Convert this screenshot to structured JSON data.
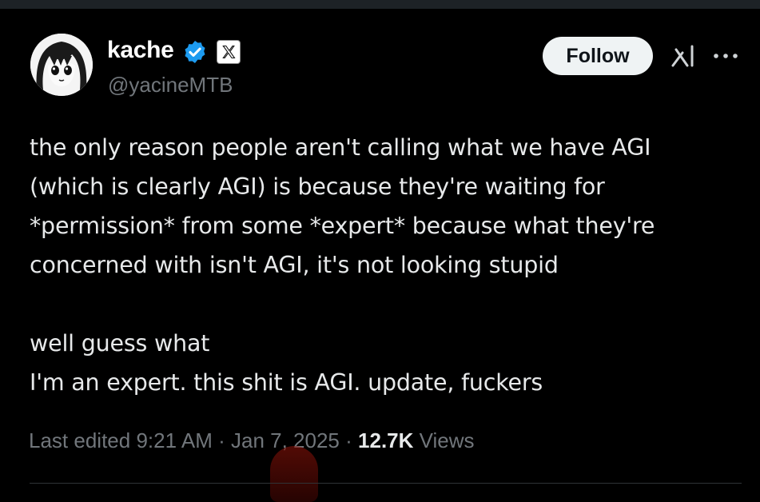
{
  "author": {
    "name": "kache",
    "handle": "@yacineMTB",
    "verified": true,
    "affiliate_badge_icon": "x-logo-icon",
    "avatar_icon": "anime-girl-avatar"
  },
  "actions": {
    "follow_label": "Follow",
    "grok_icon": "grok-icon",
    "more_icon": "more-horizontal-icon"
  },
  "tweet": {
    "lines": [
      "the only reason people aren't calling what we have AGI",
      "(which is clearly AGI) is because they're waiting for",
      "*permission* from some *expert* because what they're",
      "concerned with isn't AGI, it's not looking stupid",
      "",
      "well guess what",
      "I'm an expert. this shit is AGI. update, fuckers"
    ]
  },
  "meta": {
    "edited_label": "Last edited",
    "time": "9:21 AM",
    "separator": "·",
    "date": "Jan 7, 2025",
    "views_count": "12.7K",
    "views_label": "Views"
  },
  "colors": {
    "background": "#000000",
    "text": "#e7e9ea",
    "muted": "#71767b",
    "verified_blue": "#1d9bf0",
    "follow_bg": "#eff3f4"
  }
}
